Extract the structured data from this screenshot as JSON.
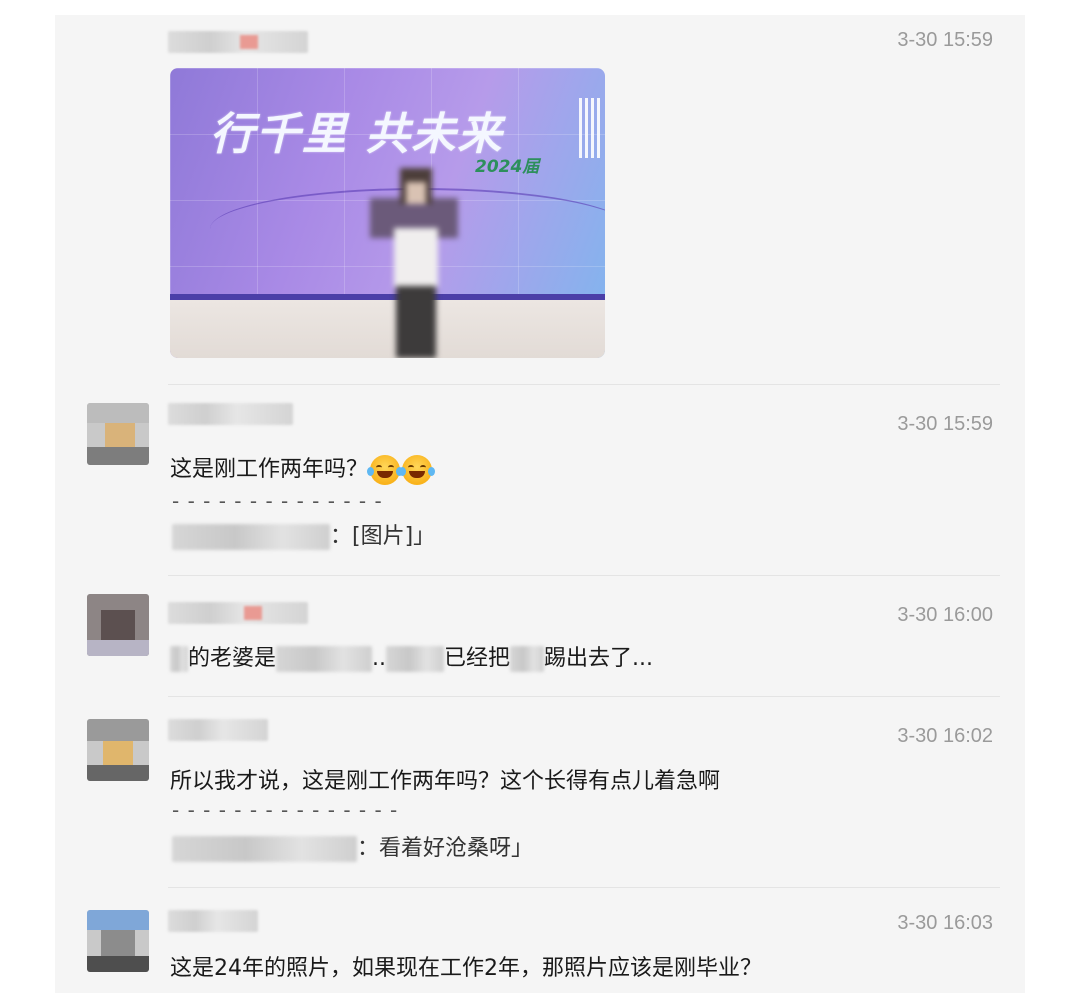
{
  "messages": [
    {
      "time": "3-30 15:59",
      "photo": {
        "slogan": "行千里 共未来",
        "year": "2024届"
      }
    },
    {
      "time": "3-30 15:59",
      "text": "这是刚工作两年吗？",
      "emoji": "joy-icon",
      "separator": "- - - - - - - - - - - - - -",
      "quote_suffix": "：[图片]」"
    },
    {
      "time": "3-30 16:00",
      "text_parts": [
        "的老婆是",
        "..",
        "已经把",
        "踢出去了..."
      ]
    },
    {
      "time": "3-30 16:02",
      "text": "所以我才说，这是刚工作两年吗？这个长得有点儿着急啊",
      "separator": "- - - - - - - - - - - - - - -",
      "quote_suffix": "：看着好沧桑呀」"
    },
    {
      "time": "3-30 16:03",
      "text": "这是24年的照片，如果现在工作2年，那照片应该是刚毕业？"
    }
  ],
  "colors": {
    "panel_bg": "#f5f5f5",
    "timestamp": "#9a9a9a",
    "divider": "#e4e4e4"
  }
}
